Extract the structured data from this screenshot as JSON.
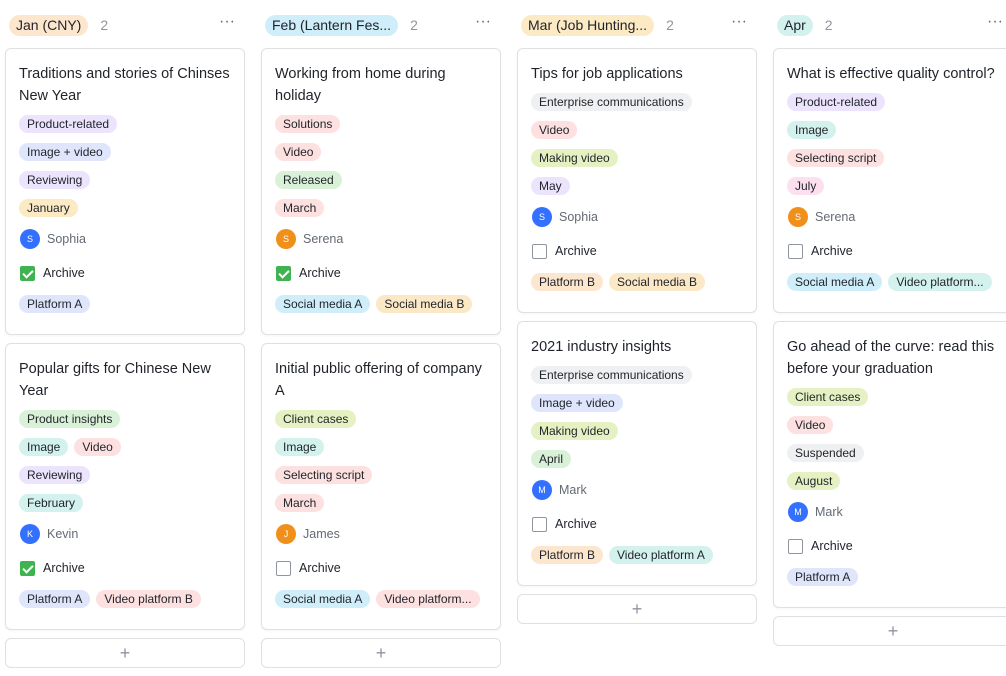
{
  "colors": {
    "orange": "#fde6ce",
    "sky": "#cfeefa",
    "yellow": "#fbeac4",
    "teal": "#d3f1ed",
    "purple": "#ece3fd",
    "blue": "#dfe6fb",
    "pink": "#fde0e0",
    "green": "#d9f1d7",
    "lime": "#e5f1c2",
    "gray": "#eff0f1",
    "amber": "#fbe8c6"
  },
  "columns": [
    {
      "title": "Jan (CNY)",
      "count": "2",
      "more": "···",
      "cards": [
        {
          "title": "Traditions and stories of Chinses New Year",
          "tags": [
            [
              "Product-related"
            ],
            [
              "Image + video"
            ],
            [
              "Reviewing"
            ],
            [
              "January"
            ]
          ],
          "person": "Sophia",
          "initial": "S",
          "archive": "Archive",
          "checked": true,
          "channels": [
            "Platform A"
          ]
        },
        {
          "title": "Popular gifts for Chinese New Year",
          "tags": [
            [
              "Product insights"
            ],
            [
              "Image",
              "Video"
            ],
            [
              "Reviewing"
            ],
            [
              "February"
            ]
          ],
          "person": "Kevin",
          "initial": "K",
          "archive": "Archive",
          "checked": true,
          "channels": [
            "Platform A",
            "Video platform B"
          ]
        }
      ],
      "add": "+"
    },
    {
      "title": "Feb (Lantern Fes...",
      "count": "2",
      "more": "···",
      "cards": [
        {
          "title": "Working from home during holiday",
          "tags": [
            [
              "Solutions"
            ],
            [
              "Video"
            ],
            [
              "Released"
            ],
            [
              "March"
            ]
          ],
          "person": "Serena",
          "initial": "S",
          "archive": "Archive",
          "checked": true,
          "channels": [
            "Social media A",
            "Social media B"
          ]
        },
        {
          "title": "Initial public offering of company A",
          "tags": [
            [
              "Client cases"
            ],
            [
              "Image"
            ],
            [
              "Selecting script"
            ],
            [
              "March"
            ]
          ],
          "person": "James",
          "initial": "J",
          "archive": "Archive",
          "checked": false,
          "channels": [
            "Social media A",
            "Video platform..."
          ]
        }
      ],
      "add": "+"
    },
    {
      "title": "Mar (Job Hunting...",
      "count": "2",
      "more": "···",
      "cards": [
        {
          "title": "Tips for job applications",
          "tags": [
            [
              "Enterprise communications"
            ],
            [
              "Video"
            ],
            [
              "Making video"
            ],
            [
              "May"
            ]
          ],
          "person": "Sophia",
          "initial": "S",
          "archive": "Archive",
          "checked": false,
          "channels": [
            "Platform B",
            "Social media B"
          ]
        },
        {
          "title": "2021 industry insights",
          "tags": [
            [
              "Enterprise communications"
            ],
            [
              "Image + video"
            ],
            [
              "Making video"
            ],
            [
              "April"
            ]
          ],
          "person": "Mark",
          "initial": "M",
          "archive": "Archive",
          "checked": false,
          "channels": [
            "Platform B",
            "Video platform A"
          ]
        }
      ],
      "add": "+"
    },
    {
      "title": "Apr",
      "count": "2",
      "more": "···",
      "cards": [
        {
          "title": "What is effective quality control?",
          "tags": [
            [
              "Product-related"
            ],
            [
              "Image"
            ],
            [
              "Selecting script"
            ],
            [
              "July"
            ]
          ],
          "person": "Serena",
          "initial": "S",
          "archive": "Archive",
          "checked": false,
          "channels": [
            "Social media A",
            "Video platform..."
          ]
        },
        {
          "title": "Go ahead of the curve: read this before your graduation",
          "tags": [
            [
              "Client cases"
            ],
            [
              "Video"
            ],
            [
              "Suspended"
            ],
            [
              "August"
            ]
          ],
          "person": "Mark",
          "initial": "M",
          "archive": "Archive",
          "checked": false,
          "channels": [
            "Platform A"
          ]
        }
      ],
      "add": "+"
    }
  ]
}
